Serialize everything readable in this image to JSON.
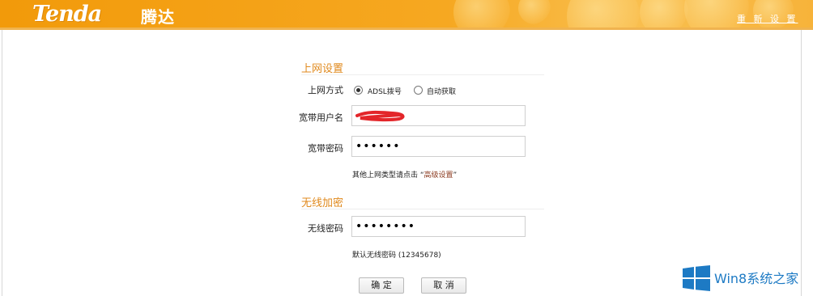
{
  "header": {
    "logo_text": "Tenda",
    "logo_cn": "腾达",
    "reset_link": "重 新 设 置",
    "colors": {
      "header_bg": "#f29a0a",
      "section_title": "#e08a1e",
      "link": "#8b3a1f"
    }
  },
  "internet": {
    "section_title": "上网设置",
    "mode_label": "上网方式",
    "modes": [
      {
        "label": "ADSL拨号",
        "checked": true
      },
      {
        "label": "自动获取",
        "checked": false
      }
    ],
    "username_label": "宽带用户名",
    "username_value": "",
    "password_label": "宽带密码",
    "password_value": "••••••",
    "hint_prefix": "其他上网类型请点击 “",
    "hint_link": "高级设置",
    "hint_suffix": "”"
  },
  "wireless": {
    "section_title": "无线加密",
    "password_label": "无线密码",
    "password_value": "••••••••",
    "default_hint": "默认无线密码 (12345678)"
  },
  "buttons": {
    "confirm": "确 定",
    "cancel": "取 消"
  },
  "watermark": {
    "text": "Win8系统之家",
    "icon": "windows-logo-icon",
    "color": "#1d7ac4"
  }
}
